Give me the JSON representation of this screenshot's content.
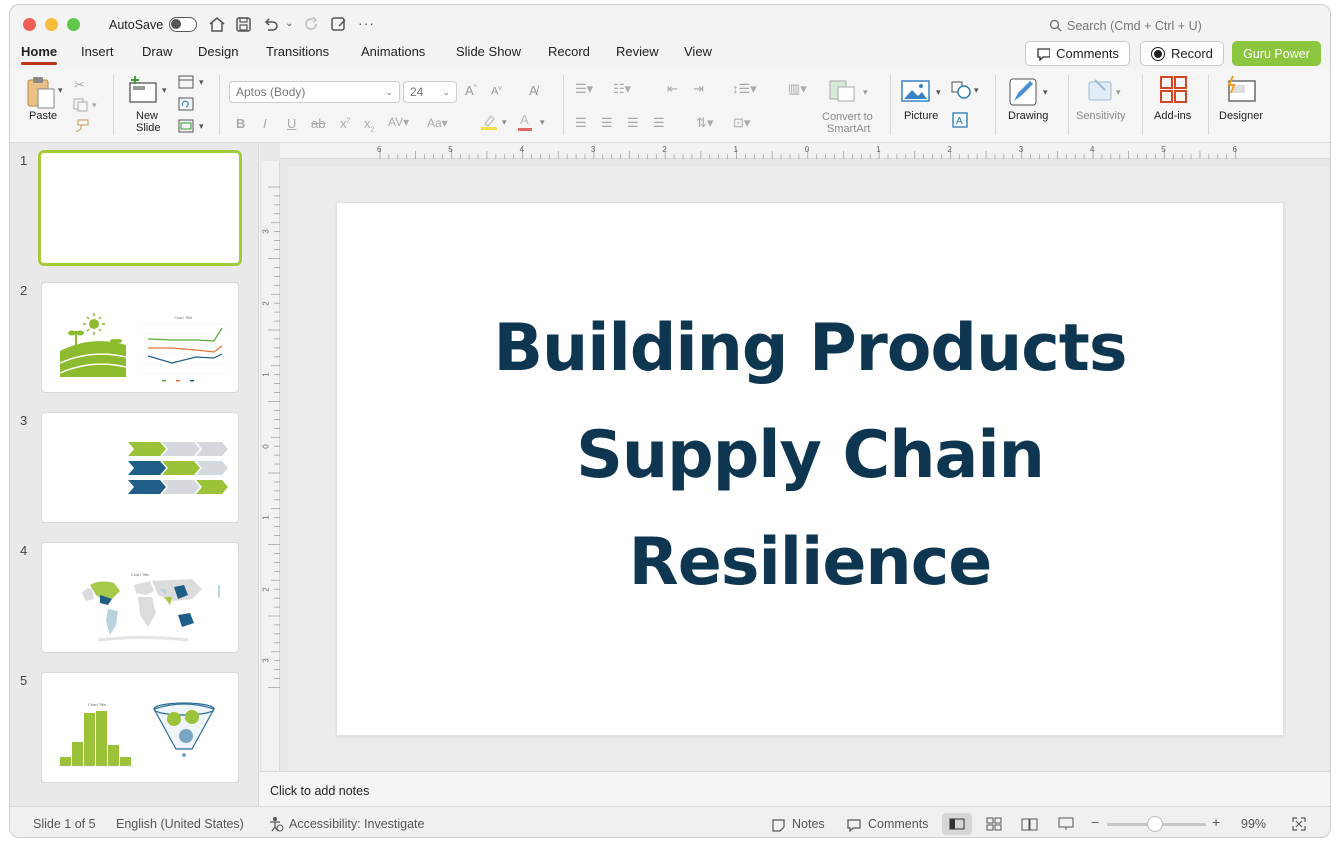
{
  "titlebar": {
    "autosave_label": "AutoSave",
    "search_placeholder": "Search (Cmd + Ctrl + U)"
  },
  "tabs": [
    {
      "label": "Home",
      "active": true
    },
    {
      "label": "Insert"
    },
    {
      "label": "Draw"
    },
    {
      "label": "Design"
    },
    {
      "label": "Transitions"
    },
    {
      "label": "Animations"
    },
    {
      "label": "Slide Show"
    },
    {
      "label": "Record"
    },
    {
      "label": "Review"
    },
    {
      "label": "View"
    }
  ],
  "header_buttons": {
    "comments": "Comments",
    "record": "Record",
    "guru": "Guru Power",
    "guru_color": "#8cc63f"
  },
  "ribbon": {
    "paste": "Paste",
    "new_slide_1": "New",
    "new_slide_2": "Slide",
    "font_name": "Aptos (Body)",
    "font_size": "24",
    "convert_1": "Convert to",
    "convert_2": "SmartArt",
    "picture": "Picture",
    "drawing": "Drawing",
    "sensitivity": "Sensitivity",
    "addins": "Add-ins",
    "designer": "Designer"
  },
  "ruler": {
    "h_labels": [
      "6",
      "5",
      "4",
      "3",
      "2",
      "1",
      "0",
      "1",
      "2",
      "3",
      "4",
      "5",
      "6"
    ],
    "v_labels": [
      "3",
      "2",
      "1",
      "0",
      "1",
      "2",
      "3"
    ]
  },
  "thumbnails": {
    "numbers": [
      "1",
      "2",
      "3",
      "4",
      "5"
    ],
    "chart_title": "Chart Title"
  },
  "slide": {
    "title_lines": [
      "Building Products",
      "Supply Chain",
      "Resilience"
    ],
    "title_color": "#0f3651"
  },
  "notes": {
    "placeholder": "Click to add notes"
  },
  "statusbar": {
    "slide_counter": "Slide 1 of 5",
    "language": "English (United States)",
    "accessibility": "Accessibility: Investigate",
    "notes": "Notes",
    "comments": "Comments",
    "zoom_minus": "−",
    "zoom_plus": "+",
    "zoom": "99%"
  }
}
